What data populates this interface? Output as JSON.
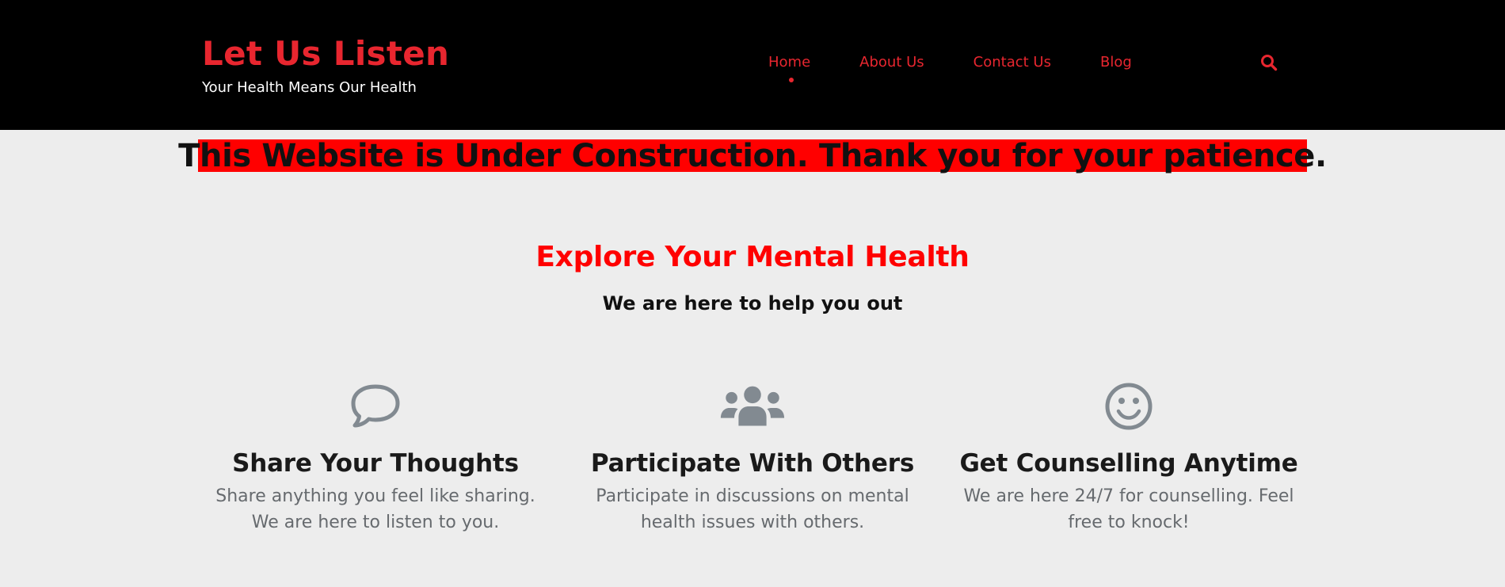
{
  "header": {
    "site_title": "Let Us Listen",
    "tagline": "Your Health Means Our Health",
    "nav": [
      {
        "label": "Home",
        "active": true
      },
      {
        "label": "About Us",
        "active": false
      },
      {
        "label": "Contact Us",
        "active": false
      },
      {
        "label": "Blog",
        "active": false
      }
    ],
    "search_icon": "search-icon"
  },
  "banner": {
    "text": "This Website is Under Construction. Thank you for your patience."
  },
  "section": {
    "title": "Explore Your Mental Health",
    "subtitle": "We are here to help you out"
  },
  "features": [
    {
      "icon": "speech-bubble-icon",
      "title": "Share Your Thoughts",
      "description": "Share anything you feel like sharing. We are here to listen to you."
    },
    {
      "icon": "group-users-icon",
      "title": "Participate With Others",
      "description": "Participate in discussions on mental health issues with others."
    },
    {
      "icon": "smiley-face-icon",
      "title": "Get Counselling Anytime",
      "description": "We are here 24/7 for counselling. Feel free to knock!"
    }
  ],
  "colors": {
    "header_bg": "#000000",
    "accent_red": "#e8262f",
    "banner_red": "#ff0000",
    "page_bg": "#ededed",
    "icon_gray": "#828a91"
  }
}
